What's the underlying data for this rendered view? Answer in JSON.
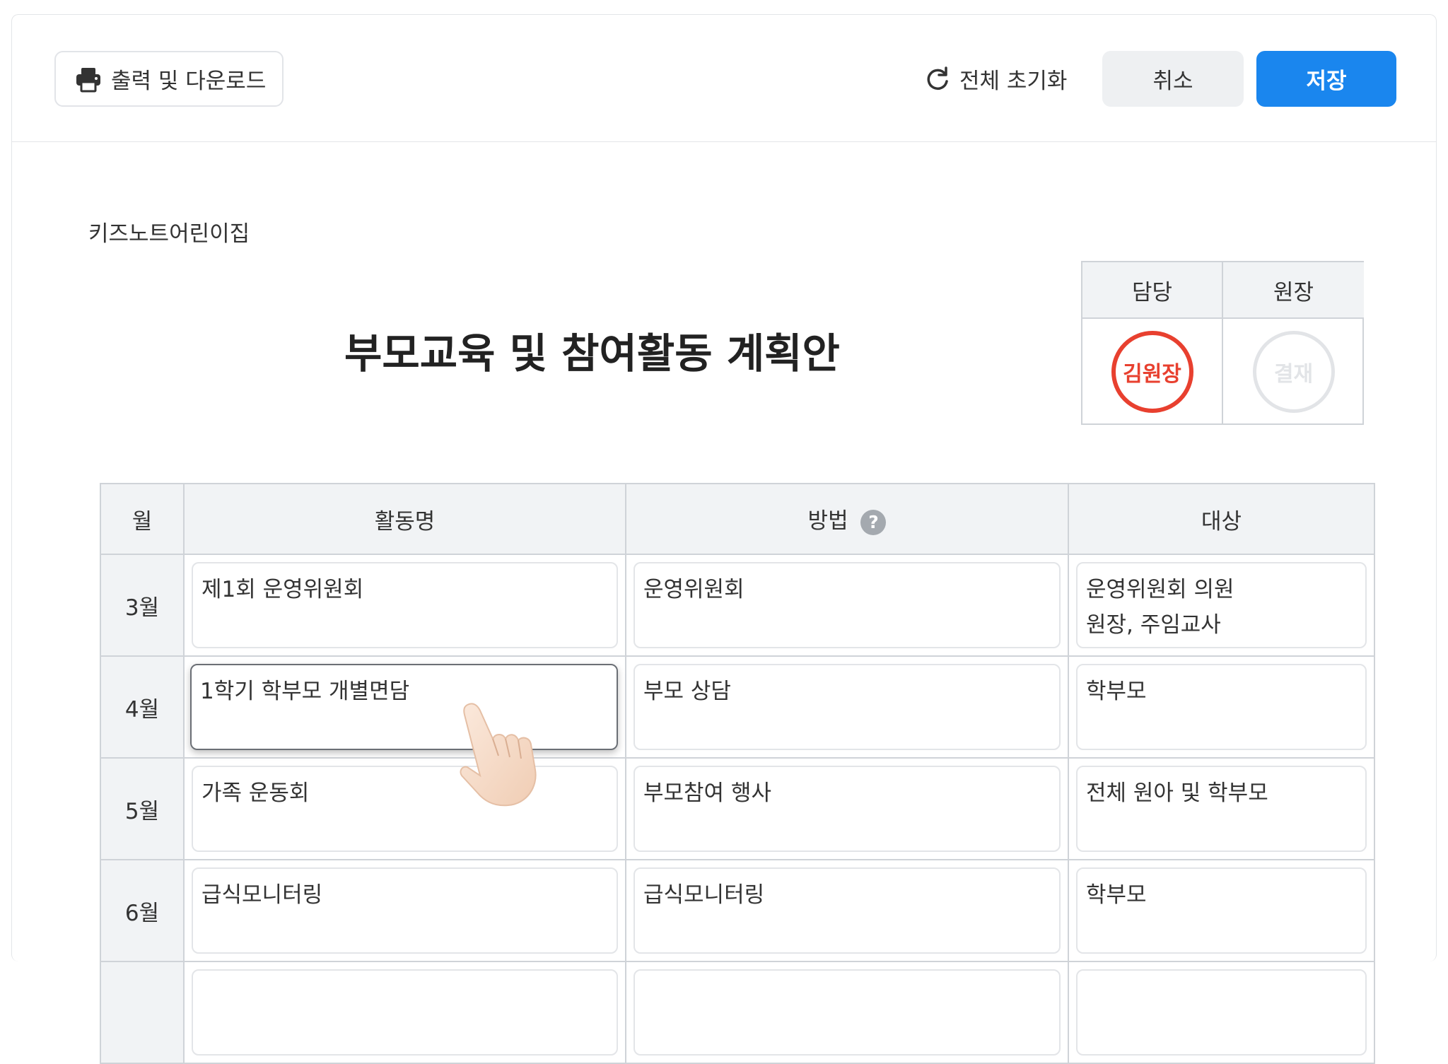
{
  "toolbar": {
    "print_label": "출력 및 다운로드",
    "print_icon": "printer-icon",
    "reset_label": "전체 초기화",
    "reset_icon": "refresh-icon",
    "cancel_label": "취소",
    "save_label": "저장"
  },
  "document": {
    "org_name": "키즈노트어린이집",
    "title": "부모교육 및 참여활동 계획안"
  },
  "approval": {
    "headers": [
      "담당",
      "원장"
    ],
    "stamps": [
      {
        "text": "김원장",
        "state": "signed",
        "color": "#e8402f"
      },
      {
        "text": "결재",
        "state": "empty",
        "color": "#e2e4e7"
      }
    ]
  },
  "table": {
    "headers": {
      "month": "월",
      "activity": "활동명",
      "method": "방법",
      "target": "대상"
    },
    "rows": [
      {
        "month": "3월",
        "activity": "제1회 운영위원회",
        "method": "운영위원회",
        "target": "운영위원회 의원\n원장, 주임교사"
      },
      {
        "month": "4월",
        "activity": "1학기 학부모 개별면담",
        "method": "부모 상담",
        "target": "학부모"
      },
      {
        "month": "5월",
        "activity": "가족 운동회",
        "method": "부모참여 행사",
        "target": "전체 원아 및 학부모"
      },
      {
        "month": "6월",
        "activity": "급식모니터링",
        "method": "급식모니터링",
        "target": "학부모"
      },
      {
        "month": "",
        "activity": "",
        "method": "",
        "target": ""
      }
    ]
  },
  "colors": {
    "accent": "#1a86ee",
    "stamp_red": "#e8402f",
    "header_bg": "#f1f3f5"
  }
}
